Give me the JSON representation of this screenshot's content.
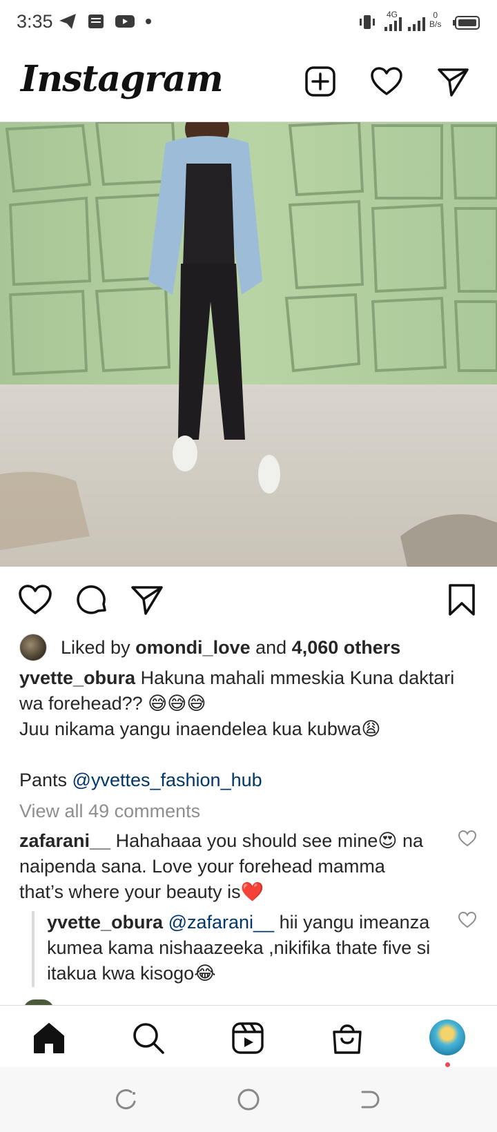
{
  "status": {
    "time": "3:35",
    "network": "4G",
    "speed_value": "0",
    "speed_unit": "B/s"
  },
  "header": {
    "logo": "Instagram",
    "icons": [
      "new-post-icon",
      "activity-heart-icon",
      "direct-message-icon"
    ]
  },
  "post": {
    "likes": {
      "prefix": "Liked by ",
      "user": "omondi_love",
      "middle": " and ",
      "count": "4,060 others"
    },
    "caption": {
      "username": "yvette_obura",
      "line1": " Hakuna mahali mmeskia Kuna daktari wa forehead?? 😅😅😅",
      "line2": "Juu nikama yangu inaendelea kua kubwa😩",
      "line3_prefix": "Pants ",
      "line3_mention": "@yvettes_fashion_hub"
    },
    "view_all_comments": "View all 49 comments",
    "comments": [
      {
        "username": "zafarani__",
        "text": " Hahahaaa you should see mine😍 na naipenda sana. Love your forehead mamma that’s where your beauty is❤️"
      }
    ],
    "reply": {
      "username": "yvette_obura",
      "mention": " @zafarani__",
      "text": " hii yangu imeanza kumea kama nishaazeeka ,nikifika thate five si itakua kwa kisogo😂"
    }
  },
  "colors": {
    "text": "#262626",
    "link": "#00376b",
    "muted": "#8e8e8e",
    "notification_dot": "#ed4956"
  },
  "bottom_nav": [
    "home-icon",
    "search-icon",
    "reels-icon",
    "shop-icon",
    "profile-avatar"
  ]
}
